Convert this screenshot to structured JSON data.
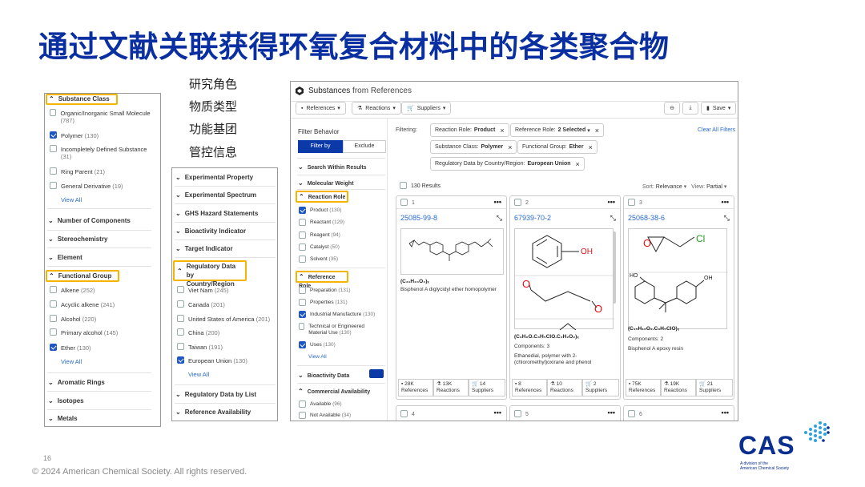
{
  "slide": {
    "title": "通过文献关联获得环氧复合材料中的各类聚合物",
    "page_number": "16",
    "copyright": "© 2024 American Chemical Society. All rights reserved.",
    "labels": [
      "研究角色",
      "物质类型",
      "功能基团",
      "管控信息"
    ]
  },
  "left_panel": {
    "substance_class": {
      "header": "Substance Class",
      "items": [
        {
          "label": "Organic/Inorganic Small Molecule",
          "count": "(787)",
          "checked": false
        },
        {
          "label": "Polymer",
          "count": "(130)",
          "checked": true
        },
        {
          "label": "Incompletely Defined Substance",
          "count": "(31)",
          "checked": false
        },
        {
          "label": "Ring Parent",
          "count": "(21)",
          "checked": false
        },
        {
          "label": "General Derivative",
          "count": "(19)",
          "checked": false
        }
      ],
      "view_all": "View All"
    },
    "collapsed_1": [
      "Number of Components",
      "Stereochemistry",
      "Element"
    ],
    "functional_group": {
      "header": "Functional Group",
      "items": [
        {
          "label": "Alkene",
          "count": "(252)",
          "checked": false
        },
        {
          "label": "Acyclic alkene",
          "count": "(241)",
          "checked": false
        },
        {
          "label": "Alcohol",
          "count": "(220)",
          "checked": false
        },
        {
          "label": "Primary alcohol",
          "count": "(145)",
          "checked": false
        },
        {
          "label": "Ether",
          "count": "(130)",
          "checked": true
        }
      ],
      "view_all": "View All"
    },
    "collapsed_2": [
      "Aromatic Rings",
      "Isotopes",
      "Metals"
    ]
  },
  "mid_panel": {
    "collapsed": [
      "Experimental Property",
      "Experimental Spectrum",
      "GHS Hazard Statements",
      "Bioactivity Indicator",
      "Target Indicator"
    ],
    "regulatory_header": "Regulatory Data by Country/Region",
    "regulatory_items": [
      {
        "label": "Viet Nam",
        "count": "(245)",
        "checked": false
      },
      {
        "label": "Canada",
        "count": "(201)",
        "checked": false
      },
      {
        "label": "United States of America",
        "count": "(201)",
        "checked": false
      },
      {
        "label": "China",
        "count": "(200)",
        "checked": false
      },
      {
        "label": "Taiwan",
        "count": "(191)",
        "checked": false
      },
      {
        "label": "European Union",
        "count": "(130)",
        "checked": true
      }
    ],
    "view_all": "View All",
    "bottom": [
      "Regulatory Data by List",
      "Reference Availability"
    ]
  },
  "app": {
    "title_bold": "Substances",
    "title_rest": " from References",
    "toolbar": {
      "references": "References",
      "reactions": "Reactions",
      "suppliers": "Suppliers",
      "save": "Save"
    },
    "filter_behavior": "Filter Behavior",
    "filter_by": "Filter by",
    "exclude": "Exclude",
    "search_within": "Search Within Results",
    "molecular_weight": "Molecular Weight",
    "reaction_role": {
      "header": "Reaction Role",
      "items": [
        {
          "label": "Product",
          "count": "(130)",
          "checked": true
        },
        {
          "label": "Reactant",
          "count": "(129)",
          "checked": false
        },
        {
          "label": "Reagent",
          "count": "(94)",
          "checked": false
        },
        {
          "label": "Catalyst",
          "count": "(50)",
          "checked": false
        },
        {
          "label": "Solvent",
          "count": "(35)",
          "checked": false
        }
      ]
    },
    "reference_role": {
      "header": "Reference Role",
      "items": [
        {
          "label": "Preparation",
          "count": "(131)",
          "checked": false
        },
        {
          "label": "Properties",
          "count": "(131)",
          "checked": false
        },
        {
          "label": "Industrial Manufacture",
          "count": "(130)",
          "checked": true
        },
        {
          "label": "Technical or Engineered Material Use",
          "count": "(130)",
          "checked": false
        },
        {
          "label": "Uses",
          "count": "(130)",
          "checked": true
        }
      ],
      "view_all": "View All"
    },
    "bioactivity": "Bioactivity Data",
    "commercial": "Commercial Availability",
    "commercial_items": [
      {
        "label": "Available",
        "count": "(96)"
      },
      {
        "label": "Not Available",
        "count": "(34)"
      }
    ],
    "filtering_label": "Filtering:",
    "chips": [
      {
        "k": "Reaction Role:",
        "v": "Product"
      },
      {
        "k": "Reference Role:",
        "v": "2 Selected"
      },
      {
        "k": "Substance Class:",
        "v": "Polymer"
      },
      {
        "k": "Functional Group:",
        "v": "Ether"
      },
      {
        "k": "Regulatory Data by Country/Region:",
        "v": "European Union"
      }
    ],
    "clear_all": "Clear All Filters",
    "results": "130 Results",
    "sort_label": "Sort:",
    "sort_value": "Relevance",
    "view_label": "View:",
    "view_value": "Partial",
    "cards": [
      {
        "num": "1",
        "cas": "25085-99-8",
        "formula": "(C₂₁H₂₄O₄)ₓ",
        "components": "",
        "name": "Bisphenol A diglycidyl ether homopolymer",
        "refs": "28K",
        "rxns": "13K",
        "sups": "14"
      },
      {
        "num": "2",
        "cas": "67939-70-2",
        "formula": "(C₆H₆O.C₃H₅ClO.C₂H₂O₂)ₓ",
        "components": "Components: 3",
        "name": "Ethanedial, polymer with 2-(chloromethyl)oxirane and phenol",
        "refs": "8",
        "rxns": "10",
        "sups": "2"
      },
      {
        "num": "3",
        "cas": "25068-38-6",
        "formula": "(C₁₅H₁₆O₂.C₃H₅ClO)ₓ",
        "components": "Components: 2",
        "name": "Bisphenol A epoxy resin",
        "refs": "75K",
        "rxns": "19K",
        "sups": "21"
      }
    ],
    "stat_labels": {
      "refs": "References",
      "rxns": "Reactions",
      "sups": "Suppliers"
    },
    "next_cards": [
      "4",
      "5",
      "6"
    ],
    "mol_labels": {
      "oh": "OH",
      "o": "O",
      "cl": "Cl",
      "ho": "HO"
    }
  },
  "logo": {
    "text": "CAS",
    "sub1": "A division of the",
    "sub2": "American Chemical Society"
  },
  "colors": {
    "title": "#0a2fa0",
    "highlight": "#f6b400",
    "accent": "#1e56c4",
    "link": "#2a6ad0"
  }
}
